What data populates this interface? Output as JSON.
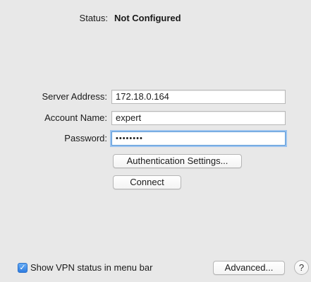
{
  "status": {
    "label": "Status:",
    "value": "Not Configured"
  },
  "form": {
    "server_address_label": "Server Address:",
    "server_address_value": "172.18.0.164",
    "account_name_label": "Account Name:",
    "account_name_value": "expert",
    "password_label": "Password:",
    "password_value": "••••••••"
  },
  "buttons": {
    "auth_settings": "Authentication Settings...",
    "connect": "Connect",
    "advanced": "Advanced...",
    "help": "?"
  },
  "footer": {
    "show_vpn_status_checked": true,
    "checkbox_mark": "✓",
    "show_vpn_status_label": "Show VPN status in menu bar"
  },
  "colors": {
    "background": "#e8e8e8",
    "focus_ring": "#9cc3ee",
    "checkbox_blue": "#2f7de1"
  }
}
